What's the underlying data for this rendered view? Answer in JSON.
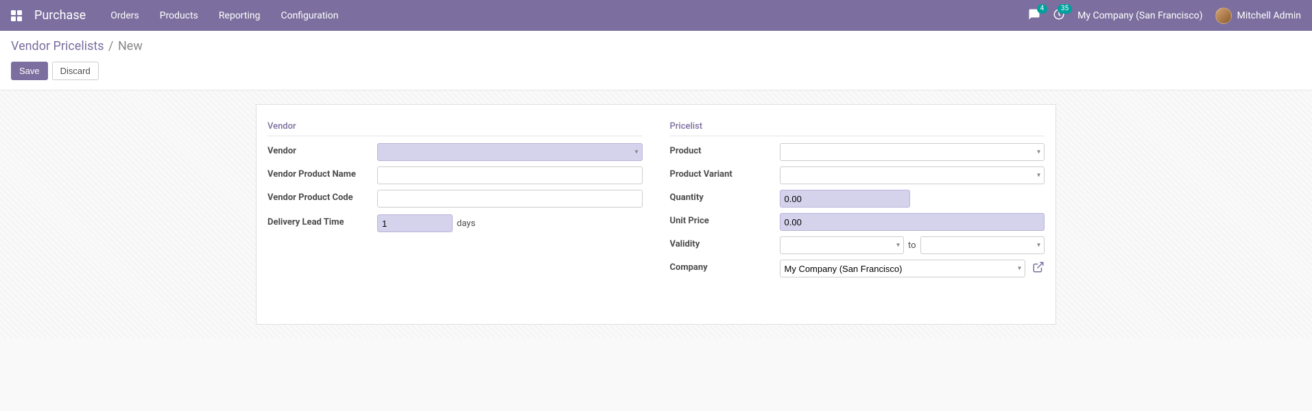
{
  "topbar": {
    "brand": "Purchase",
    "nav": [
      "Orders",
      "Products",
      "Reporting",
      "Configuration"
    ],
    "messages_badge": "4",
    "activities_badge": "35",
    "company": "My Company (San Francisco)",
    "user": "Mitchell Admin"
  },
  "breadcrumb": {
    "parent": "Vendor Pricelists",
    "current": "New"
  },
  "buttons": {
    "save": "Save",
    "discard": "Discard"
  },
  "sections": {
    "vendor": "Vendor",
    "pricelist": "Pricelist"
  },
  "labels": {
    "vendor": "Vendor",
    "vendor_product_name": "Vendor Product Name",
    "vendor_product_code": "Vendor Product Code",
    "delivery_lead_time": "Delivery Lead Time",
    "product": "Product",
    "product_variant": "Product Variant",
    "quantity": "Quantity",
    "unit_price": "Unit Price",
    "validity": "Validity",
    "company": "Company"
  },
  "values": {
    "vendor": "",
    "vendor_product_name": "",
    "vendor_product_code": "",
    "delivery_lead_time": "1",
    "delivery_lead_time_unit": "days",
    "product": "",
    "product_variant": "",
    "quantity": "0.00",
    "unit_price": "0.00",
    "validity_from": "",
    "validity_to_label": "to",
    "validity_to": "",
    "company": "My Company (San Francisco)"
  }
}
